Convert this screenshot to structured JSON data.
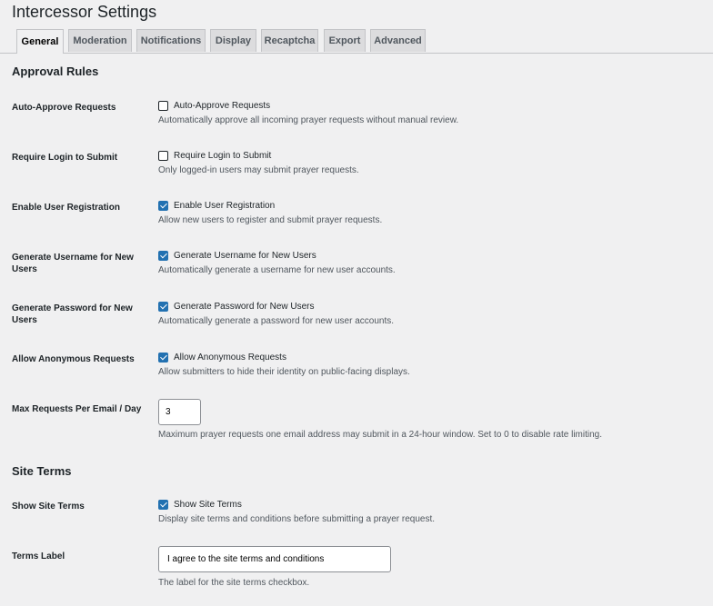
{
  "page": {
    "title": "Intercessor Settings"
  },
  "tabs": [
    {
      "label": "General",
      "active": true
    },
    {
      "label": "Moderation"
    },
    {
      "label": "Notifications"
    },
    {
      "label": "Display"
    },
    {
      "label": "Recaptcha"
    },
    {
      "label": "Export"
    },
    {
      "label": "Advanced"
    }
  ],
  "sections": {
    "approval": {
      "title": "Approval Rules"
    },
    "site_terms": {
      "title": "Site Terms"
    }
  },
  "rows": {
    "auto_approve": {
      "label": "Auto-Approve Requests",
      "checkbox_label": "Auto-Approve Requests",
      "checked": false,
      "description": "Automatically approve all incoming prayer requests without manual review."
    },
    "require_login": {
      "label": "Require Login to Submit",
      "checkbox_label": "Require Login to Submit",
      "checked": false,
      "description": "Only logged-in users may submit prayer requests."
    },
    "enable_registration": {
      "label": "Enable User Registration",
      "checkbox_label": "Enable User Registration",
      "checked": true,
      "description": "Allow new users to register and submit prayer requests."
    },
    "generate_username": {
      "label": "Generate Username for New Users",
      "checkbox_label": "Generate Username for New Users",
      "checked": true,
      "description": "Automatically generate a username for new user accounts."
    },
    "generate_password": {
      "label": "Generate Password for New Users",
      "checkbox_label": "Generate Password for New Users",
      "checked": true,
      "description": "Automatically generate a password for new user accounts."
    },
    "anonymous": {
      "label": "Allow Anonymous Requests",
      "checkbox_label": "Allow Anonymous Requests",
      "checked": true,
      "description": "Allow submitters to hide their identity on public-facing displays."
    },
    "max_requests": {
      "label": "Max Requests Per Email / Day",
      "value": "3",
      "description": "Maximum prayer requests one email address may submit in a 24-hour window. Set to 0 to disable rate limiting."
    },
    "show_terms": {
      "label": "Show Site Terms",
      "checkbox_label": "Show Site Terms",
      "checked": true,
      "description": "Display site terms and conditions before submitting a prayer request."
    },
    "terms_label": {
      "label": "Terms Label",
      "value": "I agree to the site terms and conditions",
      "description": "The label for the site terms checkbox."
    }
  },
  "colors": {
    "accent": "#2271b1",
    "background": "#f0f0f1",
    "text": "#1d2327",
    "muted": "#50575e"
  }
}
